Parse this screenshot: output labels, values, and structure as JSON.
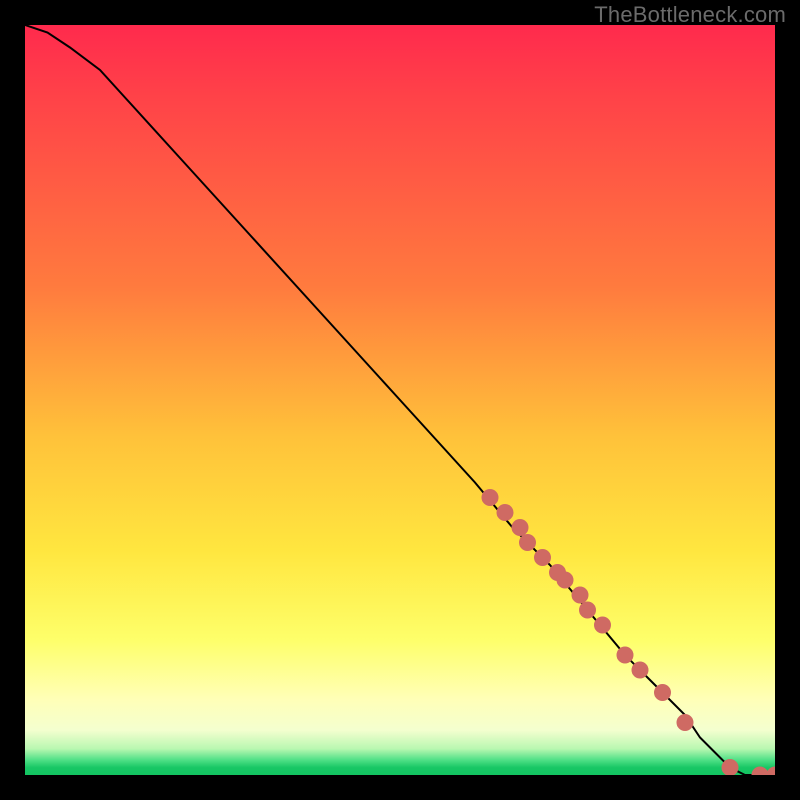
{
  "watermark": "TheBottleneck.com",
  "chart_data": {
    "type": "line",
    "title": "",
    "xlabel": "",
    "ylabel": "",
    "xlim": [
      0,
      100
    ],
    "ylim": [
      0,
      100
    ],
    "background_gradient": {
      "stops": [
        {
          "pos": 0,
          "color": "#ff2a4d"
        },
        {
          "pos": 35,
          "color": "#ff7b3e"
        },
        {
          "pos": 70,
          "color": "#ffe63f"
        },
        {
          "pos": 90,
          "color": "#ffffb8"
        },
        {
          "pos": 98,
          "color": "#4fe086"
        },
        {
          "pos": 100,
          "color": "#13c461"
        }
      ]
    },
    "series": [
      {
        "name": "bottleneck-curve",
        "x": [
          0,
          3,
          6,
          10,
          20,
          30,
          40,
          50,
          60,
          65,
          70,
          75,
          80,
          82,
          85,
          88,
          90,
          92,
          94,
          96,
          98,
          100
        ],
        "y": [
          100,
          99,
          97,
          94,
          83,
          72,
          61,
          50,
          39,
          33,
          28,
          22,
          16,
          14,
          11,
          8,
          5,
          3,
          1,
          0,
          0,
          0
        ]
      }
    ],
    "points": {
      "name": "highlighted-samples",
      "color": "#cf6a63",
      "x": [
        62,
        64,
        66,
        67,
        69,
        71,
        72,
        74,
        75,
        77,
        80,
        82,
        85,
        88,
        94,
        98,
        100
      ],
      "y": [
        37,
        35,
        33,
        31,
        29,
        27,
        26,
        24,
        22,
        20,
        16,
        14,
        11,
        7,
        1,
        0,
        0
      ]
    }
  }
}
